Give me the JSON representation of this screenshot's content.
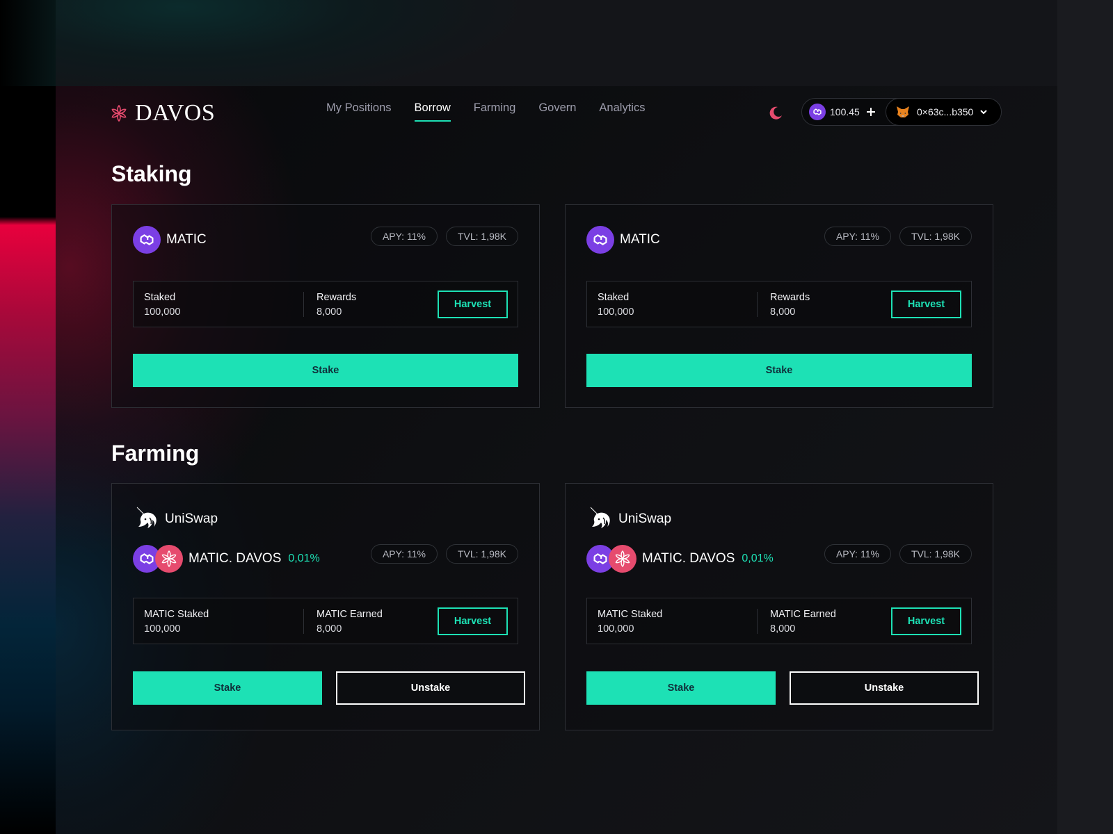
{
  "brand": {
    "name": "DAVOS",
    "accent": "#1de1b5",
    "brand_pink": "#e64b6e",
    "matic_purple": "#7b3fe4"
  },
  "nav": {
    "items": [
      {
        "label": "My Positions",
        "active": false
      },
      {
        "label": "Borrow",
        "active": true
      },
      {
        "label": "Farming",
        "active": false
      },
      {
        "label": "Govern",
        "active": false
      },
      {
        "label": "Analytics",
        "active": false
      }
    ]
  },
  "header": {
    "theme_icon": "moon-icon",
    "balance": {
      "token_icon": "polygon-matic-icon",
      "value": "100.45",
      "add_icon": "plus-icon"
    },
    "wallet": {
      "icon": "metamask-fox-icon",
      "address": "0×63c...b350",
      "dropdown_icon": "chevron-down-icon"
    }
  },
  "staking": {
    "title": "Staking",
    "cards": [
      {
        "token": "MATIC",
        "apy": "APY: 11%",
        "tvl": "TVL: 1,98K",
        "stats": [
          {
            "label": "Staked",
            "value": "100,000"
          },
          {
            "label": "Rewards",
            "value": "8,000"
          }
        ],
        "harvest_label": "Harvest",
        "stake_label": "Stake"
      },
      {
        "token": "MATIC",
        "apy": "APY: 11%",
        "tvl": "TVL: 1,98K",
        "stats": [
          {
            "label": "Staked",
            "value": "100,000"
          },
          {
            "label": "Rewards",
            "value": "8,000"
          }
        ],
        "harvest_label": "Harvest",
        "stake_label": "Stake"
      }
    ]
  },
  "farming": {
    "title": "Farming",
    "cards": [
      {
        "dex": "UniSwap",
        "pair": "MATIC. DAVOS",
        "fee": "0,01%",
        "apy": "APY: 11%",
        "tvl": "TVL: 1,98K",
        "stats": [
          {
            "label": "MATIC Staked",
            "value": "100,000"
          },
          {
            "label": "MATIC Earned",
            "value": "8,000"
          }
        ],
        "harvest_label": "Harvest",
        "stake_label": "Stake",
        "unstake_label": "Unstake"
      },
      {
        "dex": "UniSwap",
        "pair": "MATIC. DAVOS",
        "fee": "0,01%",
        "apy": "APY: 11%",
        "tvl": "TVL: 1,98K",
        "stats": [
          {
            "label": "MATIC Staked",
            "value": "100,000"
          },
          {
            "label": "MATIC Earned",
            "value": "8,000"
          }
        ],
        "harvest_label": "Harvest",
        "stake_label": "Stake",
        "unstake_label": "Unstake"
      }
    ]
  }
}
